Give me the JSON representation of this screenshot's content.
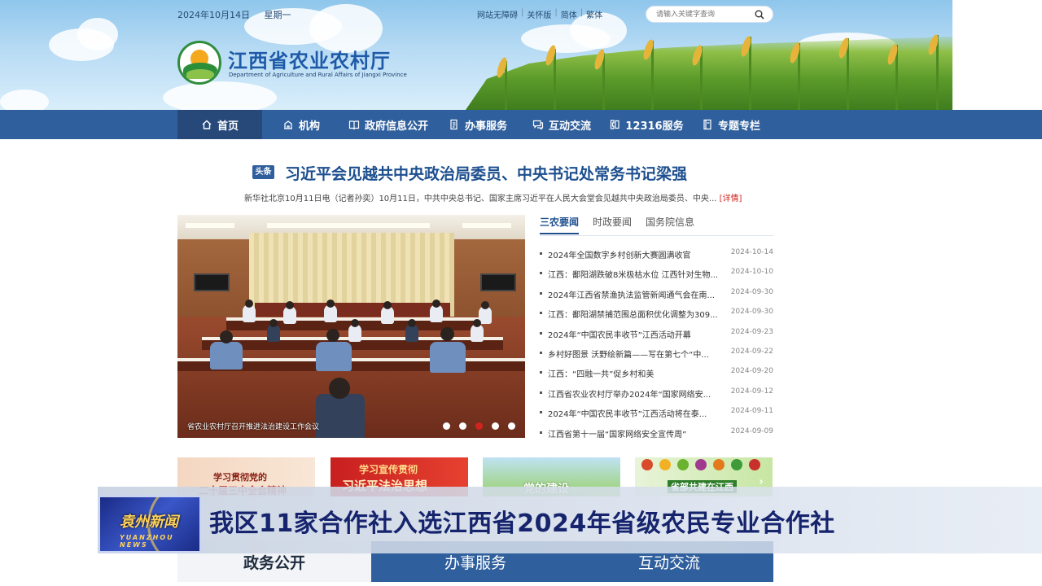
{
  "header": {
    "date": "2024年10月14日",
    "weekday": "星期一",
    "links": [
      "网站无障碍",
      "关怀版",
      "简体",
      "繁体"
    ],
    "search_placeholder": "请输入关键字查询",
    "site_title": "江西省农业农村厅",
    "site_subtitle": "Department of Agriculture and Rural Affairs of Jiangxi Province"
  },
  "nav": {
    "items": [
      {
        "label": "首页",
        "icon": "home-icon"
      },
      {
        "label": "机构",
        "icon": "building-icon"
      },
      {
        "label": "政府信息公开",
        "icon": "book-icon"
      },
      {
        "label": "办事服务",
        "icon": "document-icon"
      },
      {
        "label": "互动交流",
        "icon": "chat-icon"
      },
      {
        "label": "12316服务",
        "icon": "phone-icon"
      },
      {
        "label": "专题专栏",
        "icon": "notebook-icon"
      }
    ]
  },
  "headline": {
    "badge": "头条",
    "title": "习近平会见越共中央政治局委员、中央书记处常务书记梁强",
    "summary": "新华社北京10月11日电（记者孙奕）10月11日，中共中央总书记、国家主席习近平在人民大会堂会见越共中央政治局委员、中央...",
    "more": "[详情]"
  },
  "photo": {
    "caption": "省农业农村厅召开推进法治建设工作会议"
  },
  "news": {
    "tabs": [
      "三农要闻",
      "时政要闻",
      "国务院信息"
    ],
    "items": [
      {
        "title": "2024年全国数字乡村创新大赛圆满收官",
        "date": "2024-10-14"
      },
      {
        "title": "江西：鄱阳湖跌破8米极枯水位 江西针对生物...",
        "date": "2024-10-10"
      },
      {
        "title": "2024年江西省禁渔执法监管新闻通气会在南...",
        "date": "2024-09-30"
      },
      {
        "title": "江西：鄱阳湖禁捕范围总面积优化调整为309...",
        "date": "2024-09-30"
      },
      {
        "title": "2024年“中国农民丰收节”江西活动开幕",
        "date": "2024-09-23"
      },
      {
        "title": "乡村好图景 沃野绘新篇——写在第七个“中...",
        "date": "2024-09-22"
      },
      {
        "title": "江西：“四融一共”促乡村和美",
        "date": "2024-09-20"
      },
      {
        "title": "江西省农业农村厅举办2024年“国家网络安...",
        "date": "2024-09-12"
      },
      {
        "title": "2024年“中国农民丰收节”江西活动将在泰...",
        "date": "2024-09-11"
      },
      {
        "title": "江西省第十一届“国家网络安全宣传周”",
        "date": "2024-09-09"
      }
    ]
  },
  "banners": {
    "b1_line1": "学习贯彻党的",
    "b1_line2": "二十届三中全会精神",
    "b2_line1": "学习宣传贯彻",
    "b2_line2": "习近平法治思想",
    "b3_line1": "党的建设",
    "b4_line1": "省部共建在江西"
  },
  "bottom_tabs": [
    "政务公开",
    "办事服务",
    "互动交流"
  ],
  "ticker": {
    "logo_cn": "袁州新闻",
    "logo_en": "YUANZHOU NEWS",
    "headline": "我区11家合作社入选江西省2024年省级农民专业合作社"
  },
  "colors": {
    "nav_blue": "#2f5f9c",
    "title_blue": "#1d4f8f",
    "accent_red": "#d2231f"
  }
}
